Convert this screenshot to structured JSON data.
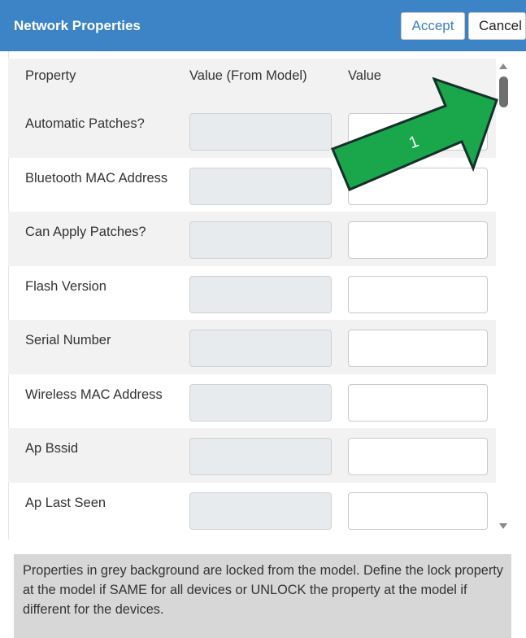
{
  "header": {
    "title": "Network Properties",
    "accept_label": "Accept",
    "cancel_label": "Cancel",
    "color": "#3d84c6"
  },
  "table": {
    "columns": [
      "Property",
      "Value (From Model)",
      "Value"
    ],
    "rows": [
      {
        "label": "Automatic Patches?"
      },
      {
        "label": "Bluetooth MAC Address"
      },
      {
        "label": "Can Apply Patches?"
      },
      {
        "label": "Flash Version"
      },
      {
        "label": "Serial Number"
      },
      {
        "label": "Wireless MAC Address"
      },
      {
        "label": "Ap Bssid"
      },
      {
        "label": "Ap Last Seen"
      }
    ]
  },
  "info_text": "Properties in grey background are locked from the model. Define the lock property at the model if SAME for all devices or UNLOCK the property at the model if different for the devices.",
  "callout": {
    "label": "1",
    "color": "#1aa64a"
  }
}
